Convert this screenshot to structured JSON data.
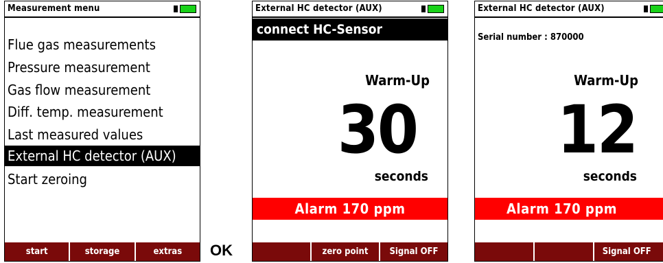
{
  "screen1": {
    "title": "Measurement menu",
    "menu": [
      "Flue gas measurements",
      "Pressure measurement",
      "Gas flow measurement",
      "Diff. temp. measurement",
      "Last measured values",
      "External HC detector (AUX)",
      "Start zeroing"
    ],
    "selected_index": 5,
    "softkeys": [
      "start",
      "storage",
      "extras"
    ]
  },
  "ok_label": "OK",
  "screen2": {
    "title": "External HC detector (AUX)",
    "banner": "connect HC-Sensor",
    "status": "Warm-Up",
    "countdown": "30",
    "unit": "seconds",
    "alarm": "Alarm  170 ppm",
    "softkeys": [
      "",
      "zero point",
      "Signal OFF"
    ]
  },
  "screen3": {
    "title": "External HC detector (AUX)",
    "serial": "Serial number : 870000",
    "status": "Warm-Up",
    "countdown": "12",
    "unit": "seconds",
    "alarm": "Alarm  170 ppm",
    "softkeys": [
      "",
      "",
      "Signal OFF"
    ]
  },
  "colors": {
    "softkey_bar": "#7a0a0a",
    "alarm": "#ff0000",
    "battery": "#19d219",
    "highlight": "#000000"
  },
  "icons": {
    "battery": "battery-full-icon"
  }
}
